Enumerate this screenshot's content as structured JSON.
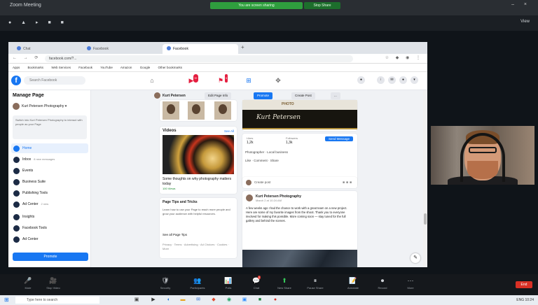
{
  "zoom": {
    "title": "Zoom Meeting",
    "share_banner": "You are screen sharing",
    "stop_share": "Stop Share",
    "view_label": "View"
  },
  "browser": {
    "tabs": [
      {
        "label": "Chat"
      },
      {
        "label": "Facebook"
      },
      {
        "label": "Facebook"
      }
    ],
    "url": "facebook.com/?...",
    "bookmarks": [
      "Apps",
      "Bookmarks",
      "Web Services",
      "Facebook",
      "YouTube",
      "Amazon",
      "Google",
      "Other bookmarks"
    ]
  },
  "facebook": {
    "search_placeholder": "Search Facebook",
    "notif_counts": [
      "9+",
      "3"
    ],
    "manage_page_title": "Manage Page",
    "page_name": "Kurt Petersen Photography",
    "page_note": "Switch into Kurt Petersen Photography to interact with people as your Page",
    "menu": [
      {
        "label": "Home",
        "sub": ""
      },
      {
        "label": "Inbox",
        "sub": "8 new messages"
      },
      {
        "label": "Events",
        "sub": ""
      },
      {
        "label": "Business Suite",
        "sub": ""
      },
      {
        "label": "Publishing Tools",
        "sub": ""
      },
      {
        "label": "Ad Center",
        "sub": "2 new"
      },
      {
        "label": "Insights",
        "sub": ""
      },
      {
        "label": "Facebook Tools",
        "sub": ""
      },
      {
        "label": "Ad Center",
        "sub": ""
      }
    ],
    "promote": "Promote",
    "pagebar_name": "Kurt Petersen",
    "pagebar_buttons": [
      "Edit Page Info",
      "Promote",
      "Create Post",
      "..."
    ],
    "videos_title": "Videos",
    "see_all": "See All",
    "video_caption": "Some thoughts on why photography matters today",
    "video_meta": "100 Views",
    "tips_title": "Page Tips and Tricks",
    "tips_text": "Learn how to use your Page to reach more people and grow your audience with helpful resources.",
    "tips_link": "See all Page Tips",
    "footer": "Privacy · Terms · Advertising · Ad Choices · Cookies · More",
    "cover_label": "PHOTO",
    "cover_signature": "Kurt Petersen",
    "likes_label": "Likes",
    "likes": "1,2k",
    "followers_label": "Followers",
    "followers": "1,3k",
    "send_message": "Send Message",
    "info_rows": [
      "Photographer · Local business",
      "Like · Comment · Share"
    ],
    "create_post": "Create post",
    "post_author": "Kurt Petersen Photography",
    "post_date": "March 2 at 10:24 AM",
    "post_body": "A few weeks ago I had the chance to work with a great team on a new project. Here are some of my favorite images from the shoot. Thank you to everyone involved for making this possible. More coming soon — stay tuned for the full gallery and behind the scenes."
  },
  "toolbar": {
    "items": [
      {
        "icon": "🎤",
        "label": "Mute"
      },
      {
        "icon": "🎥",
        "label": "Stop Video"
      },
      {
        "icon": "🛡",
        "label": "Security"
      },
      {
        "icon": "👥",
        "label": "Participants"
      },
      {
        "icon": "📊",
        "label": "Polls"
      },
      {
        "icon": "💬",
        "label": "Chat"
      },
      {
        "icon": "⬆",
        "label": "New Share"
      },
      {
        "icon": "⏸",
        "label": "Pause Share"
      },
      {
        "icon": "📝",
        "label": "Annotate"
      },
      {
        "icon": "⏺",
        "label": "Record"
      },
      {
        "icon": "⋯",
        "label": "More"
      }
    ],
    "chat_badge": "2",
    "end": "End"
  },
  "taskbar": {
    "search": "Type here to search",
    "tray": "ENG 10:24"
  }
}
